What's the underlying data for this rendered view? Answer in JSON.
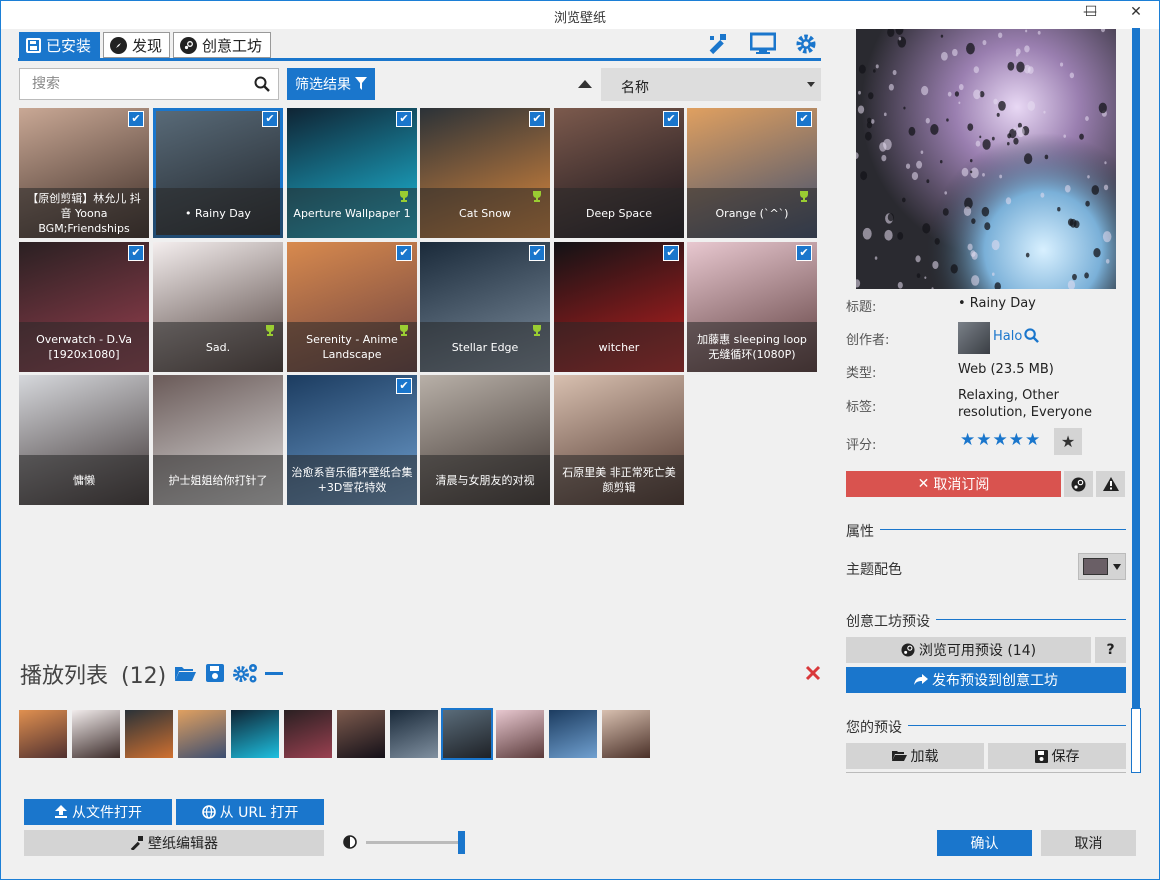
{
  "window": {
    "title": "浏览壁纸",
    "minimize": "—",
    "maximize": "☐",
    "close": "✕"
  },
  "tabs": [
    {
      "label": "已安装",
      "active": true
    },
    {
      "label": "发现",
      "active": false
    },
    {
      "label": "创意工坊",
      "active": false
    }
  ],
  "toolbar_icons": [
    "brush-icon",
    "monitor-icon",
    "gear-icon"
  ],
  "search": {
    "placeholder": "搜索",
    "value": ""
  },
  "filter": {
    "label": "筛选结果"
  },
  "sort": {
    "direction": "ascending",
    "selected": "名称"
  },
  "wallpapers": [
    {
      "caption": "【原创剪辑】林允儿 抖音 Yoona BGM;Friendships",
      "checked": true,
      "trophy": false,
      "colors": [
        "#c9a895",
        "#3a2a24"
      ]
    },
    {
      "caption": "• Rainy Day",
      "checked": true,
      "trophy": false,
      "selected": true,
      "colors": [
        "#5a6c7a",
        "#1e2126"
      ]
    },
    {
      "caption": "Aperture Wallpaper 1",
      "checked": true,
      "trophy": true,
      "colors": [
        "#0f2434",
        "#1ec0e0"
      ]
    },
    {
      "caption": "Cat Snow",
      "checked": true,
      "trophy": true,
      "colors": [
        "#2b3238",
        "#e08a3c"
      ]
    },
    {
      "caption": "Deep Space",
      "checked": true,
      "trophy": false,
      "colors": [
        "#7c5a4d",
        "#141018"
      ]
    },
    {
      "caption": "Orange (`^`)",
      "checked": true,
      "trophy": true,
      "colors": [
        "#e0a060",
        "#3b4d70"
      ]
    },
    {
      "caption": "Overwatch - D.Va [1920x1080]",
      "checked": true,
      "trophy": false,
      "colors": [
        "#2a2022",
        "#9a4050"
      ]
    },
    {
      "caption": "Sad.",
      "checked": false,
      "trophy": true,
      "colors": [
        "#f4eeee",
        "#4a3a36"
      ]
    },
    {
      "caption": "Serenity - Anime Landscape",
      "checked": true,
      "trophy": true,
      "colors": [
        "#d88a4e",
        "#6a4040"
      ]
    },
    {
      "caption": "Stellar Edge",
      "checked": true,
      "trophy": true,
      "colors": [
        "#1a2a3a",
        "#8090a0"
      ]
    },
    {
      "caption": "witcher",
      "checked": true,
      "trophy": false,
      "colors": [
        "#121215",
        "#c02020"
      ]
    },
    {
      "caption": "加藤惠 sleeping loop 无缝循环(1080P)",
      "checked": true,
      "trophy": false,
      "colors": [
        "#e8c8d0",
        "#5a3a3a"
      ]
    },
    {
      "caption": "慵懒",
      "checked": false,
      "trophy": false,
      "colors": [
        "#d6d8dc",
        "#3a3030"
      ]
    },
    {
      "caption": "护士姐姐给你打针了",
      "checked": false,
      "trophy": false,
      "colors": [
        "#6a5a58",
        "#e0e0e0"
      ]
    },
    {
      "caption": "治愈系音乐循环壁纸合集+3D雪花特效",
      "checked": true,
      "trophy": false,
      "colors": [
        "#1c3c60",
        "#70a0d0"
      ]
    },
    {
      "caption": "清晨与女朋友的对视",
      "checked": false,
      "trophy": false,
      "colors": [
        "#b8b0a8",
        "#3a302c"
      ]
    },
    {
      "caption": "石原里美 非正常死亡美颜剪辑",
      "checked": false,
      "trophy": false,
      "colors": [
        "#d8c0b0",
        "#4a3028"
      ]
    }
  ],
  "playlist": {
    "title": "播放列表",
    "count": "(12)",
    "thumbs": [
      {
        "colors": [
          "#e09050",
          "#503030"
        ]
      },
      {
        "colors": [
          "#f2ecec",
          "#3a2a28"
        ]
      },
      {
        "colors": [
          "#2a3238",
          "#d07030"
        ]
      },
      {
        "colors": [
          "#e0a060",
          "#3b4d70"
        ]
      },
      {
        "colors": [
          "#0f2434",
          "#1ec0e0"
        ]
      },
      {
        "colors": [
          "#2a2022",
          "#9a4050"
        ]
      },
      {
        "colors": [
          "#7c5a4d",
          "#141018"
        ]
      },
      {
        "colors": [
          "#1a2a3a",
          "#8090a0"
        ]
      },
      {
        "colors": [
          "#5a6c7a",
          "#1e2126"
        ],
        "selected": true
      },
      {
        "colors": [
          "#e8c8d0",
          "#5a3a3a"
        ]
      },
      {
        "colors": [
          "#1c3c60",
          "#70a0d0"
        ]
      },
      {
        "colors": [
          "#d8c0b0",
          "#4a3028"
        ]
      }
    ]
  },
  "bottom": {
    "open_file": "从文件打开",
    "open_url": "从 URL 打开",
    "editor": "壁纸编辑器",
    "brightness": 1.0,
    "ok": "确认",
    "cancel": "取消"
  },
  "details": {
    "title_label": "标题:",
    "title_value": "• Rainy Day",
    "author_label": "创作者:",
    "author_value": "Halo",
    "type_label": "类型:",
    "type_value": "Web (23.5 MB)",
    "tags_label": "标签:",
    "tags_value": "Relaxing, Other resolution, Everyone",
    "rating_label": "评分:",
    "rating_stars": "★★★★★",
    "unsubscribe": "取消订阅",
    "props_title": "属性",
    "theme_color_label": "主题配色",
    "theme_color_value": "#6a5f66",
    "workshop_presets_title": "创意工坊预设",
    "browse_presets": "浏览可用预设 (14)",
    "help": "?",
    "publish_presets": "发布预设到创意工坊",
    "your_presets_title": "您的预设",
    "load": "加载",
    "save": "保存"
  },
  "colors": {
    "accent": "#1a76cc",
    "danger": "#d9534f",
    "close_red": "#d9383a",
    "trophy": "#9acd32"
  }
}
